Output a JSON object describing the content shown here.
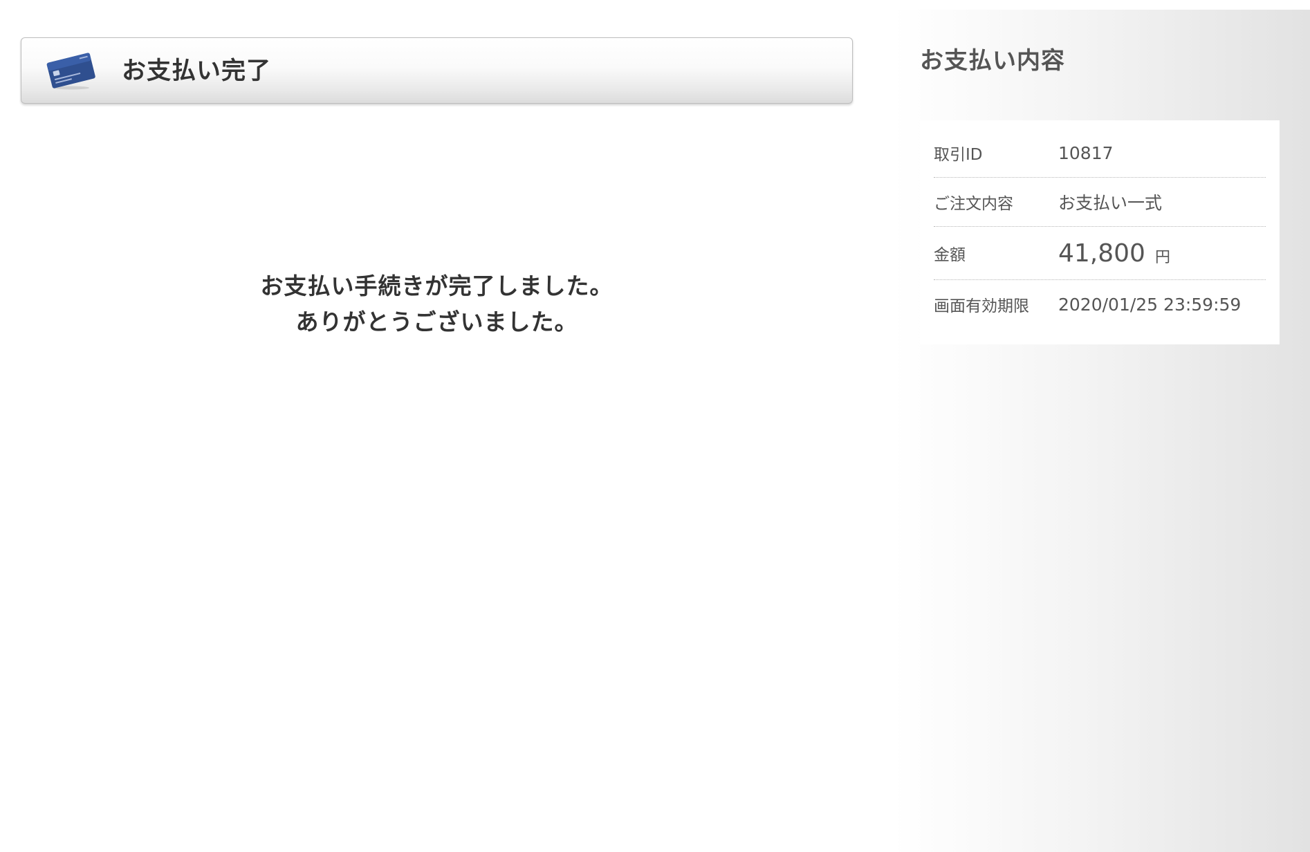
{
  "main": {
    "title": "お支払い完了",
    "message_line1": "お支払い手続きが完了しました。",
    "message_line2": "ありがとうございました。"
  },
  "side": {
    "title": "お支払い内容",
    "rows": [
      {
        "label": "取引ID",
        "value": "10817"
      },
      {
        "label": "ご注文内容",
        "value": "お支払い一式"
      },
      {
        "label": "金額",
        "value": "41,800",
        "unit": "円"
      },
      {
        "label": "画面有効期限",
        "value": "2020/01/25 23:59:59"
      }
    ]
  },
  "icons": {
    "title_icon": "credit-card-icon"
  },
  "colors": {
    "card_blue": "#2f4f8f",
    "text_dark": "#333333",
    "text_muted": "#555555"
  }
}
